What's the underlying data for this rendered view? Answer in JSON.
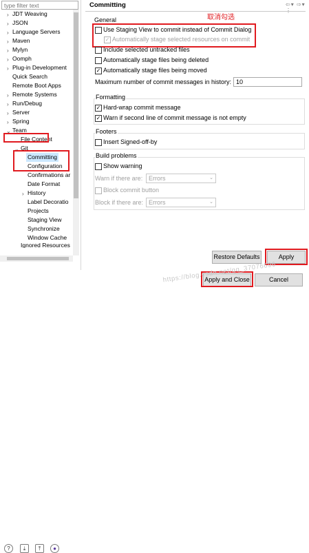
{
  "filter": {
    "placeholder": "type filter text"
  },
  "tree": {
    "items": [
      {
        "label": "JDT Weaving"
      },
      {
        "label": "JSON"
      },
      {
        "label": "Language Servers"
      },
      {
        "label": "Maven"
      },
      {
        "label": "Mylyn"
      },
      {
        "label": "Oomph"
      },
      {
        "label": "Plug-in Development"
      },
      {
        "label": "Quick Search"
      },
      {
        "label": "Remote Boot Apps"
      },
      {
        "label": "Remote Systems"
      },
      {
        "label": "Run/Debug"
      },
      {
        "label": "Server"
      },
      {
        "label": "Spring"
      },
      {
        "label": "Team"
      },
      {
        "label": "File Content"
      },
      {
        "label": "Git"
      },
      {
        "label": "Committing"
      },
      {
        "label": "Configuration"
      },
      {
        "label": "Confirmations ar"
      },
      {
        "label": "Date Format"
      },
      {
        "label": "History"
      },
      {
        "label": "Label Decoratio"
      },
      {
        "label": "Projects"
      },
      {
        "label": "Staging View"
      },
      {
        "label": "Synchronize"
      },
      {
        "label": "Window Cache"
      },
      {
        "label": "Ignored Resources"
      }
    ]
  },
  "page": {
    "title": "Committing"
  },
  "annotation": "取消勾选",
  "general": {
    "title": "General",
    "use_staging": {
      "label": "Use Staging View to commit instead of Commit Dialog",
      "checked": false
    },
    "auto_stage_selected": {
      "label": "Automatically stage selected resources on commit",
      "checked": true
    }
  },
  "options": {
    "include_untracked": {
      "label": "Include selected untracked files",
      "checked": false
    },
    "auto_stage_deleted": {
      "label": "Automatically stage files being deleted",
      "checked": false
    },
    "auto_stage_moved": {
      "label": "Automatically stage files being moved",
      "checked": true
    },
    "max_history_label": "Maximum number of commit messages in history:",
    "max_history_value": "10"
  },
  "formatting": {
    "title": "Formatting",
    "hard_wrap": {
      "label": "Hard-wrap commit message",
      "checked": true
    },
    "warn_second_line": {
      "label": "Warn if second line of commit message is not empty",
      "checked": true
    }
  },
  "footers": {
    "title": "Footers",
    "signed_off": {
      "label": "Insert Signed-off-by",
      "checked": false
    }
  },
  "build_problems": {
    "title": "Build problems",
    "show_warning": {
      "label": "Show warning",
      "checked": false
    },
    "warn_if_label": "Warn if there are:",
    "warn_if_value": "Errors",
    "block_commit": {
      "label": "Block commit button",
      "checked": false
    },
    "block_if_label": "Block if there are:",
    "block_if_value": "Errors"
  },
  "buttons": {
    "restore_defaults": "Restore Defaults",
    "apply": "Apply",
    "apply_close": "Apply and Close",
    "cancel": "Cancel"
  },
  "watermark": "https://blog.csdn.net/qq_37076696",
  "icons": [
    "help-icon",
    "import-icon",
    "export-icon",
    "oomph-icon"
  ]
}
